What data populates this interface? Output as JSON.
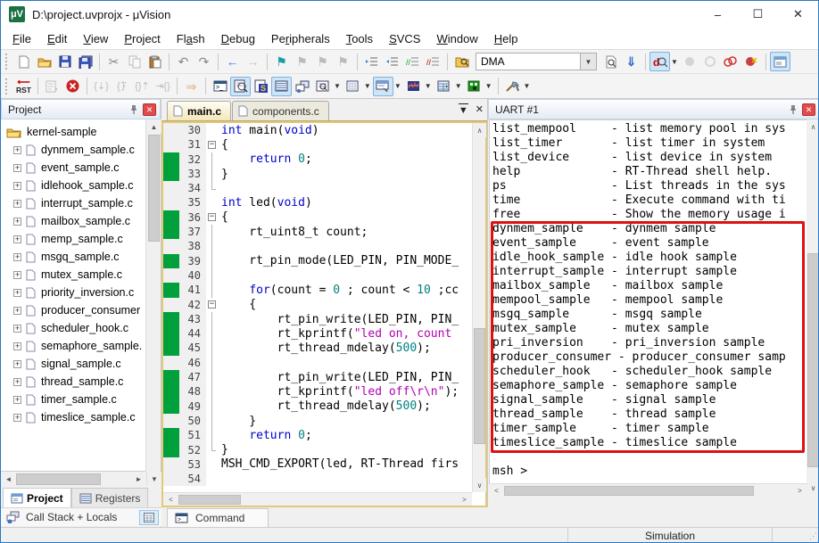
{
  "window": {
    "title": "D:\\project.uvprojx - μVision"
  },
  "menu": {
    "items": [
      {
        "label": "File",
        "u": 0
      },
      {
        "label": "Edit",
        "u": 0
      },
      {
        "label": "View",
        "u": 0
      },
      {
        "label": "Project",
        "u": 0
      },
      {
        "label": "Flash",
        "u": 2
      },
      {
        "label": "Debug",
        "u": 0
      },
      {
        "label": "Peripherals",
        "u": 2
      },
      {
        "label": "Tools",
        "u": 0
      },
      {
        "label": "SVCS",
        "u": 0
      },
      {
        "label": "Window",
        "u": 0
      },
      {
        "label": "Help",
        "u": 0
      }
    ]
  },
  "toolbar": {
    "dma_value": "DMA",
    "rst_label": "RST"
  },
  "project_panel": {
    "header": "Project",
    "root_label": "kernel-sample",
    "files": [
      "dynmem_sample.c",
      "event_sample.c",
      "idlehook_sample.c",
      "interrupt_sample.c",
      "mailbox_sample.c",
      "memp_sample.c",
      "msgq_sample.c",
      "mutex_sample.c",
      "priority_inversion.c",
      "producer_consumer",
      "scheduler_hook.c",
      "semaphore_sample.",
      "signal_sample.c",
      "thread_sample.c",
      "timer_sample.c",
      "timeslice_sample.c"
    ]
  },
  "editor": {
    "tabs": [
      {
        "label": "main.c",
        "active": true
      },
      {
        "label": "components.c",
        "active": false
      }
    ],
    "lines": [
      {
        "n": 30,
        "c": 0,
        "f": "",
        "t": [
          [
            "k",
            "int"
          ],
          [
            "p",
            " main("
          ],
          [
            "k",
            "void"
          ],
          [
            "p",
            ")"
          ]
        ]
      },
      {
        "n": 31,
        "c": 0,
        "f": "box",
        "t": [
          [
            "p",
            "{"
          ]
        ]
      },
      {
        "n": 32,
        "c": 1,
        "f": "line",
        "t": [
          [
            "p",
            "    "
          ],
          [
            "k",
            "return"
          ],
          [
            "p",
            " "
          ],
          [
            "n",
            "0"
          ],
          [
            "p",
            ";"
          ]
        ]
      },
      {
        "n": 33,
        "c": 1,
        "f": "line",
        "t": [
          [
            "p",
            "}"
          ]
        ]
      },
      {
        "n": 34,
        "c": 0,
        "f": "end",
        "t": []
      },
      {
        "n": 35,
        "c": 0,
        "f": "",
        "t": [
          [
            "k",
            "int"
          ],
          [
            "p",
            " led("
          ],
          [
            "k",
            "void"
          ],
          [
            "p",
            ")"
          ]
        ]
      },
      {
        "n": 36,
        "c": 1,
        "f": "box",
        "t": [
          [
            "p",
            "{"
          ]
        ]
      },
      {
        "n": 37,
        "c": 1,
        "f": "line",
        "t": [
          [
            "p",
            "    rt_uint8_t count;"
          ]
        ]
      },
      {
        "n": 38,
        "c": 0,
        "f": "line",
        "t": []
      },
      {
        "n": 39,
        "c": 1,
        "f": "line",
        "t": [
          [
            "p",
            "    rt_pin_mode(LED_PIN, PIN_MODE_"
          ]
        ]
      },
      {
        "n": 40,
        "c": 0,
        "f": "line",
        "t": []
      },
      {
        "n": 41,
        "c": 1,
        "f": "line",
        "t": [
          [
            "p",
            "    "
          ],
          [
            "k",
            "for"
          ],
          [
            "p",
            "(count = "
          ],
          [
            "n",
            "0"
          ],
          [
            "p",
            " ; count < "
          ],
          [
            "n",
            "10"
          ],
          [
            "p",
            " ;cc"
          ]
        ]
      },
      {
        "n": 42,
        "c": 0,
        "f": "box",
        "t": [
          [
            "p",
            "    {"
          ]
        ]
      },
      {
        "n": 43,
        "c": 1,
        "f": "line",
        "t": [
          [
            "p",
            "        rt_pin_write(LED_PIN, PIN_"
          ]
        ]
      },
      {
        "n": 44,
        "c": 1,
        "f": "line",
        "t": [
          [
            "p",
            "        rt_kprintf("
          ],
          [
            "s",
            "\"led on, count"
          ]
        ]
      },
      {
        "n": 45,
        "c": 1,
        "f": "line",
        "t": [
          [
            "p",
            "        rt_thread_mdelay("
          ],
          [
            "n",
            "500"
          ],
          [
            "p",
            ");"
          ]
        ]
      },
      {
        "n": 46,
        "c": 0,
        "f": "line",
        "t": []
      },
      {
        "n": 47,
        "c": 1,
        "f": "line",
        "t": [
          [
            "p",
            "        rt_pin_write(LED_PIN, PIN_"
          ]
        ]
      },
      {
        "n": 48,
        "c": 1,
        "f": "line",
        "t": [
          [
            "p",
            "        rt_kprintf("
          ],
          [
            "s",
            "\"led off\\r\\n\""
          ],
          [
            "p",
            ");"
          ]
        ]
      },
      {
        "n": 49,
        "c": 1,
        "f": "line",
        "t": [
          [
            "p",
            "        rt_thread_mdelay("
          ],
          [
            "n",
            "500"
          ],
          [
            "p",
            ");"
          ]
        ]
      },
      {
        "n": 50,
        "c": 0,
        "f": "line",
        "t": [
          [
            "p",
            "    }"
          ]
        ]
      },
      {
        "n": 51,
        "c": 1,
        "f": "line",
        "t": [
          [
            "p",
            "    "
          ],
          [
            "k",
            "return"
          ],
          [
            "p",
            " "
          ],
          [
            "n",
            "0"
          ],
          [
            "p",
            ";"
          ]
        ]
      },
      {
        "n": 52,
        "c": 1,
        "f": "end",
        "t": [
          [
            "p",
            "}"
          ]
        ]
      },
      {
        "n": 53,
        "c": 0,
        "f": "",
        "t": [
          [
            "p",
            "MSH_CMD_EXPORT(led, RT-Thread firs"
          ]
        ]
      },
      {
        "n": 54,
        "c": 0,
        "f": "",
        "t": []
      }
    ]
  },
  "uart": {
    "header": "UART #1",
    "lines": [
      "list_mempool     - list memory pool in sys",
      "list_timer       - list timer in system",
      "list_device      - list device in system",
      "help             - RT-Thread shell help.",
      "ps               - List threads in the sys",
      "time             - Execute command with ti",
      "free             - Show the memory usage i",
      "dynmem_sample    - dynmem sample",
      "event_sample     - event sample",
      "idle_hook_sample - idle hook sample",
      "interrupt_sample - interrupt sample",
      "mailbox_sample   - mailbox sample",
      "mempool_sample   - mempool sample",
      "msgq_sample      - msgq sample",
      "mutex_sample     - mutex sample",
      "pri_inversion    - pri_inversion sample",
      "producer_consumer - producer_consumer samp",
      "scheduler_hook   - scheduler_hook sample",
      "semaphore_sample - semaphore sample",
      "signal_sample    - signal sample",
      "thread_sample    - thread sample",
      "timer_sample     - timer sample",
      "timeslice_sample - timeslice sample",
      "",
      "msh >"
    ],
    "highlight": {
      "from": 7,
      "to": 22,
      "color": "#dd1111"
    }
  },
  "bottom": {
    "panel_tabs": [
      {
        "label": "Project",
        "active": true
      },
      {
        "label": "Registers",
        "active": false
      }
    ],
    "callstack_label": "Call Stack + Locals",
    "command_tab": "Command"
  },
  "status": {
    "mode": "Simulation"
  },
  "colors": {
    "keyword": "#0000cc",
    "number": "#008080",
    "string": "#b000b0",
    "changebar": "#00a03c",
    "annotation": "#dd1111",
    "selected_button": "#cde5f7"
  }
}
